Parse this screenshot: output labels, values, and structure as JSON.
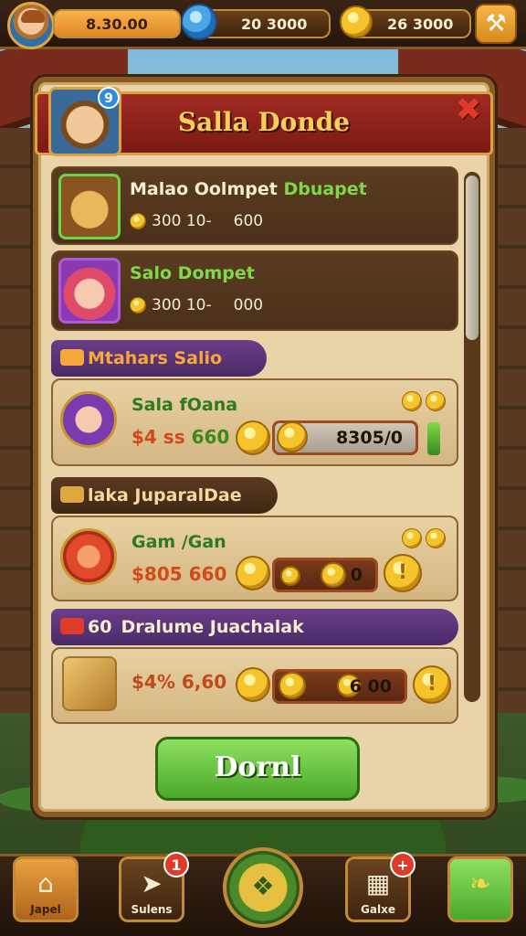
{
  "topbar": {
    "energy_value": "8.30.00",
    "gem_value": "20  3000",
    "coin_value": "26  3000",
    "tool_icon": "hammer-icon"
  },
  "panel": {
    "title": "Salla Donde",
    "portrait_badge": "9",
    "close_icon": "close-icon"
  },
  "offers": [
    {
      "title": "Malao Oolmpet",
      "tag": "Dbuapet",
      "sub_left": "300 10-",
      "sub_right": "600",
      "icon": "treasure-chest-icon"
    },
    {
      "title": "Salo Dompet",
      "tag": "",
      "sub_left": "300 10-",
      "sub_right": "000",
      "icon": "hero-portrait-icon"
    }
  ],
  "sections": [
    {
      "header": "Mtahars Salio",
      "card_name": "Sala fOana",
      "price_a": "$4 ss",
      "price_b": "660",
      "bar_label": "8305/0",
      "icon": "hero-medallion-icon"
    },
    {
      "header": "laka JuparalDae",
      "card_name": "Gam /Gan",
      "price_a": "$805",
      "price_b": "660",
      "bar_label": "0",
      "icon": "axe-medallion-icon"
    },
    {
      "header": "Dralume Juachalak",
      "header_prefix": "60",
      "card_name": "",
      "price_a": "$4%",
      "price_b": "6,60",
      "bar_label": "6 00",
      "icon": "crate-icon"
    }
  ],
  "done_label": "Dornl",
  "nav": [
    {
      "label": "Japel",
      "icon": "home-icon"
    },
    {
      "label": "Sulens",
      "icon": "quiver-icon",
      "badge": "1"
    },
    {
      "label": "",
      "icon": "emblem-icon"
    },
    {
      "label": "Galxe",
      "icon": "shop-icon",
      "badge": "+"
    },
    {
      "label": "",
      "icon": "leaf-icon"
    }
  ],
  "colors": {
    "accent_green": "#4aa82a",
    "banner_red": "#8a1e18",
    "gold": "#f5c42c",
    "section_purple": "#5a3478"
  }
}
